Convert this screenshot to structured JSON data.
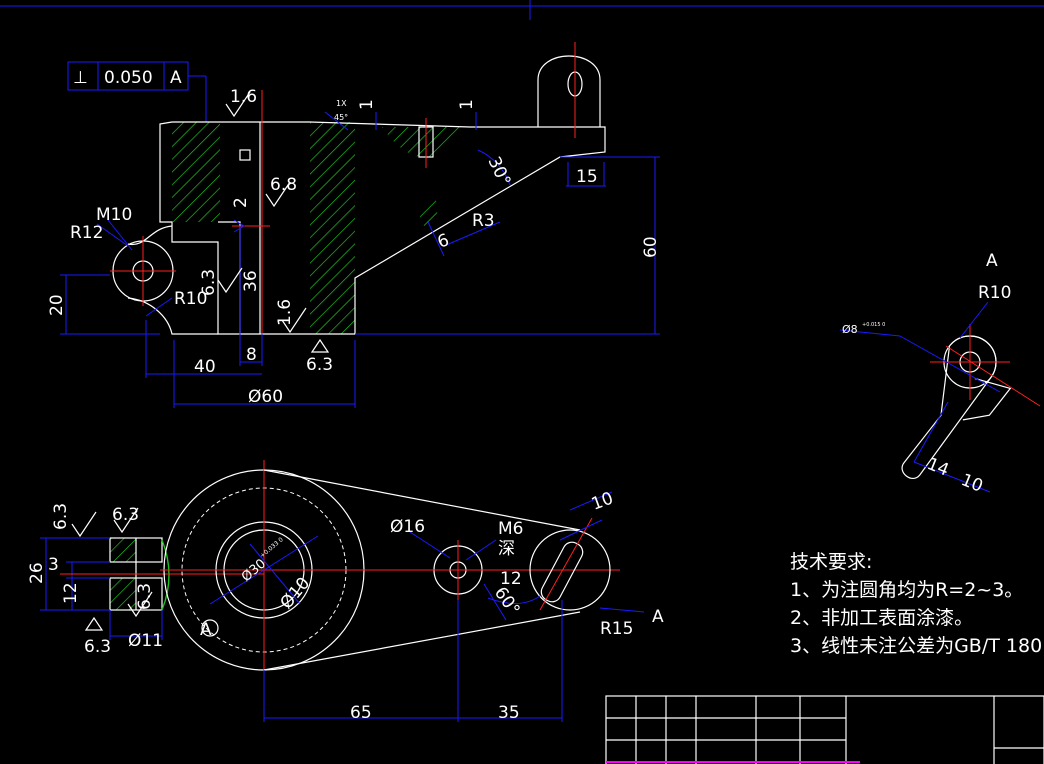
{
  "drawing": {
    "tolerance_frame": {
      "symbol": "⊥",
      "value": "0.050",
      "datum": "A"
    },
    "front_view_dims": {
      "rough_top": "1.6",
      "rough_mid": "6.8",
      "rough_side": "1.6",
      "rough_bottom": "6.3",
      "rough_left": "6.3",
      "chamfer_1x": "1X",
      "chamfer_45": "45°",
      "one_a": "1",
      "one_b": "1",
      "two": "2",
      "angle_30": "30°",
      "fifteen": "15",
      "r3": "R3",
      "six": "6",
      "sixty": "60",
      "m10": "M10",
      "r12": "R12",
      "r10": "R10",
      "thirtysix": "36",
      "twenty": "20",
      "forty": "40",
      "eight": "8",
      "dia60": "Ø60"
    },
    "detail_view_dims": {
      "label_a": "A",
      "r10": "R10",
      "dia8": "Ø8",
      "dia8_tol": "+0.015 0",
      "fourteen": "14",
      "ten": "10"
    },
    "top_view_dims": {
      "rough_a": "6.3",
      "rough_b": "6.3",
      "rough_c": "6.3",
      "rough_d": "6.3",
      "twentysix": "26",
      "three": "3",
      "twelve_left": "12",
      "dia11": "Ø11",
      "circle_a": "A",
      "dia30": "Ø30",
      "dia30_tol": "+0.033 0",
      "dia10": "Ø10",
      "dia16": "Ø16",
      "m6": "M6",
      "deep": "深",
      "twelve": "12",
      "angle_60": "60°",
      "ten": "10",
      "r15": "R15",
      "view_a": "A",
      "sixtyfive": "65",
      "thirtyfive": "35"
    },
    "tech_requirements": {
      "title": "技术要求:",
      "items": [
        "1、为注圆角均为R=2~3。",
        "2、非加工表面涂漆。",
        "3、线性未注公差为GB/T 180"
      ]
    }
  },
  "colors": {
    "background": "#000000",
    "outline": "#ffffff",
    "dimension": "#1a1aff",
    "centerline": "#ff2020",
    "hatch": "#1fbf1f",
    "title_block_text": "#ff00ff"
  }
}
